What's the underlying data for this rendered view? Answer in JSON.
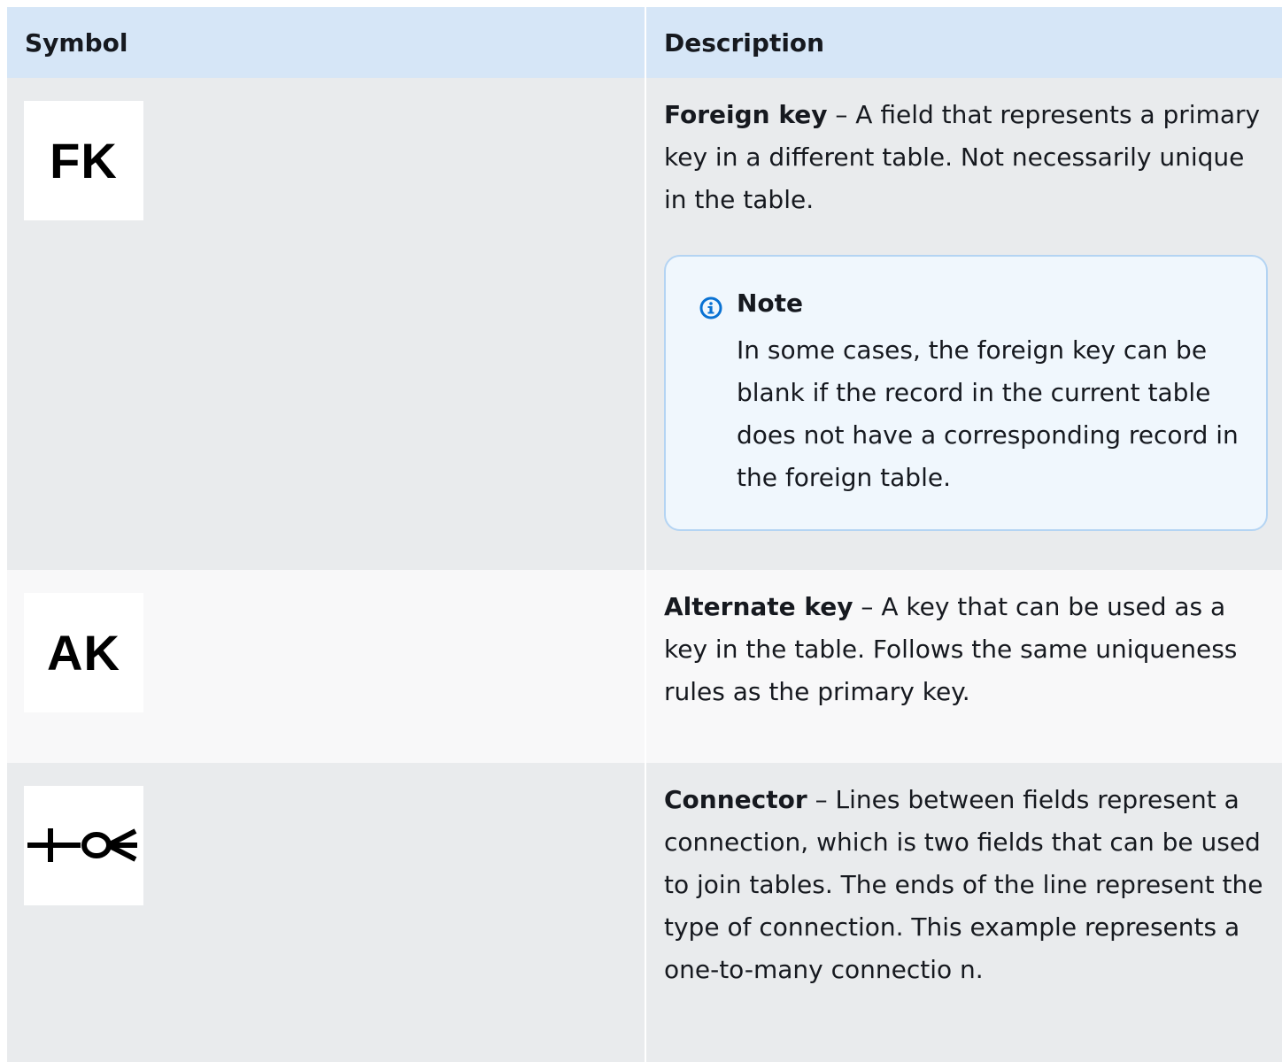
{
  "table": {
    "headers": {
      "symbol": "Symbol",
      "description": "Description"
    },
    "rows": [
      {
        "symbol": "FK",
        "term": "Foreign key",
        "text": " – A field that represents a primary key in a different table. Not necessarily unique in the table.",
        "note": {
          "title": "Note",
          "body": "In some cases, the foreign key can be blank if the record in the current table does not have a corresponding record in the foreign table."
        }
      },
      {
        "symbol": "AK",
        "term": "Alternate key",
        "text": " – A key that can be used as a key in the table. Follows the same uniqueness rules as the primary key."
      },
      {
        "symbol_icon": "one-to-many-connector-icon",
        "term": "Connector",
        "text": " – Lines between fields represent a connection, which is two fields that can be used to join tables. The ends of the line represent the type of connection. This example represents a one-to-many connectio n."
      }
    ]
  },
  "colors": {
    "header_bg": "#d6e6f7",
    "row_gray": "#e9ebed",
    "row_light": "#f8f8f9",
    "note_border": "#b4d4f3",
    "note_bg": "#f0f7fd",
    "info_icon": "#0972d3"
  }
}
